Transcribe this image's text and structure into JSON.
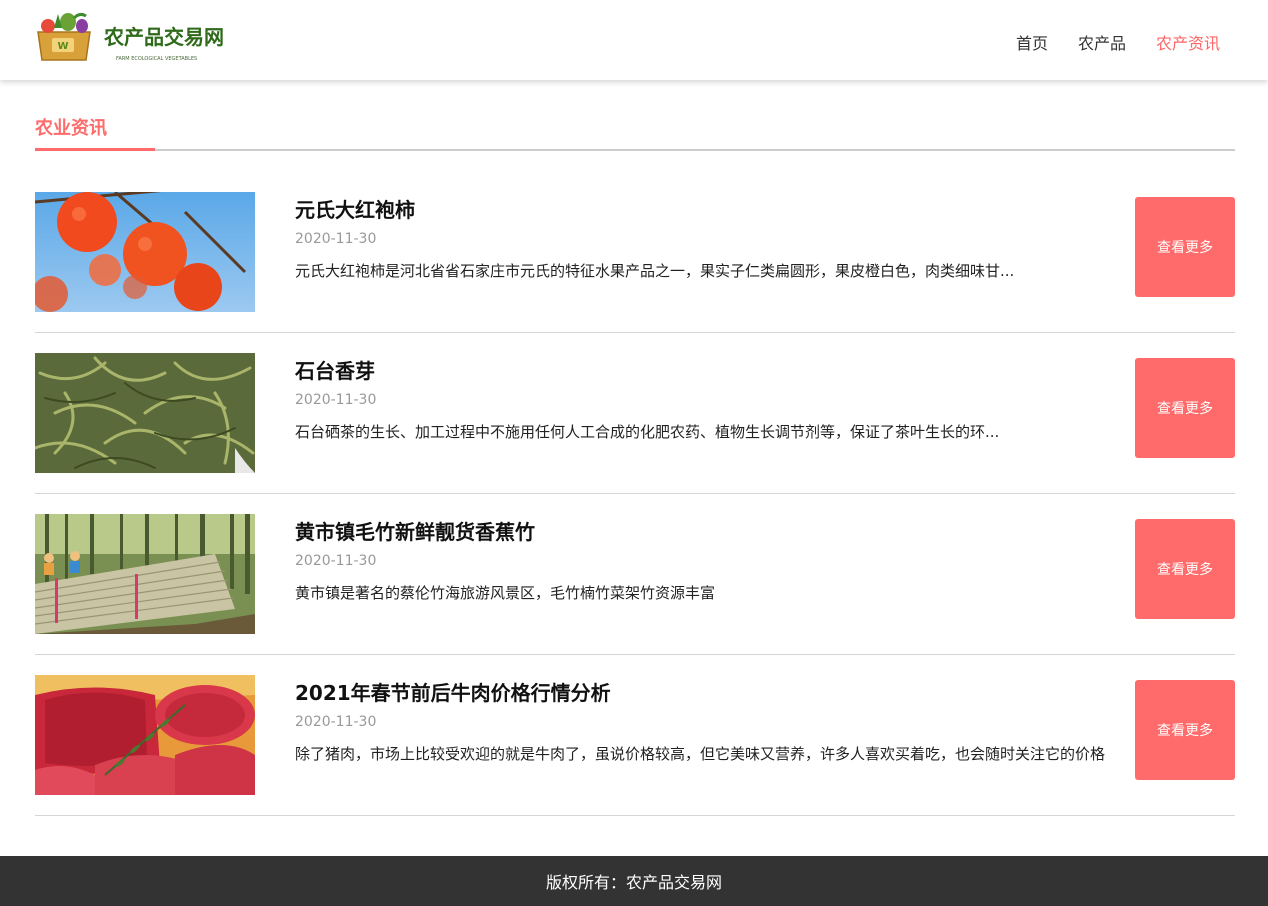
{
  "header": {
    "logo_text": "农产品交易网",
    "logo_subtext": "FARM ECOLOGICAL VEGETABLES",
    "nav": [
      {
        "label": "首页"
      },
      {
        "label": "农产品"
      },
      {
        "label": "农产资讯",
        "active": true
      }
    ]
  },
  "section": {
    "title": "农业资讯"
  },
  "articles": [
    {
      "title": "元氏大红袍柿",
      "date": "2020-11-30",
      "summary": "元氏大红袍柿是河北省省石家庄市元氏的特征水果产品之一，果实子仁类扁圆形，果皮橙白色，肉类细味甘...",
      "button": "查看更多",
      "image": "persimmon-photo"
    },
    {
      "title": "石台香芽",
      "date": "2020-11-30",
      "summary": "石台硒茶的生长、加工过程中不施用任何人工合成的化肥农药、植物生长调节剂等，保证了茶叶生长的环...",
      "button": "查看更多",
      "image": "tea-leaves-photo"
    },
    {
      "title": "黄市镇毛竹新鲜靓货香蕉竹",
      "date": "2020-11-30",
      "summary": "黄市镇是著名的蔡伦竹海旅游风景区，毛竹楠竹菜架竹资源丰富",
      "button": "查看更多",
      "image": "bamboo-photo"
    },
    {
      "title": "2021年春节前后牛肉价格行情分析",
      "date": "2020-11-30",
      "summary": "除了猪肉，市场上比较受欢迎的就是牛肉了，虽说价格较高，但它美味又营养，许多人喜欢买着吃，也会随时关注它的价格",
      "button": "查看更多",
      "image": "beef-photo"
    }
  ],
  "footer": {
    "text": "版权所有：农产品交易网"
  },
  "colors": {
    "accent": "#ff6a6a",
    "footer_bg": "#333333"
  }
}
